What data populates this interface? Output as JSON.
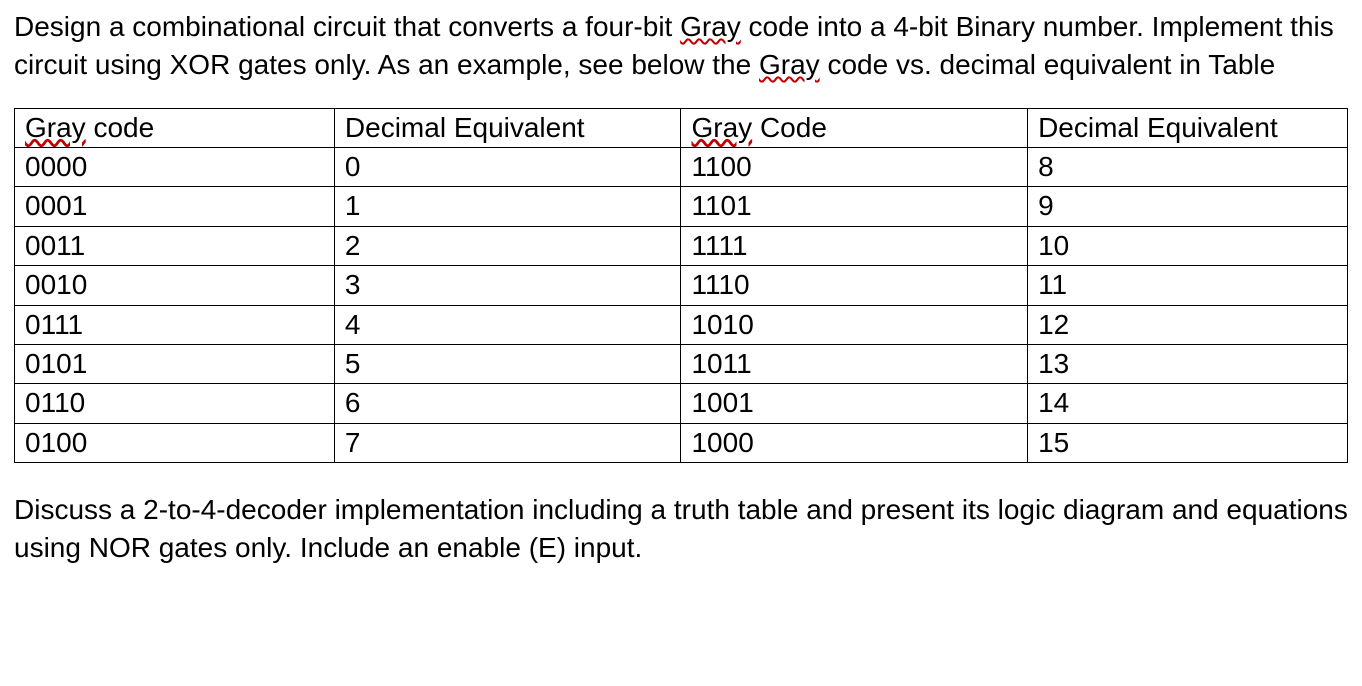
{
  "intro": {
    "seg1": "Design a combinational circuit that converts a four-bit ",
    "gray1": "Gray",
    "seg2": " code into a 4-bit Binary number. Implement this circuit using XOR gates only. As an example, see below the ",
    "gray2": "Gray",
    "seg3": " code vs. decimal equivalent in Table"
  },
  "table": {
    "headers": {
      "h1a": "Gray",
      "h1b": " code",
      "h2": "Decimal Equivalent",
      "h3a": "Gray",
      "h3b": " Code",
      "h4": "Decimal Equivalent"
    },
    "rows": [
      {
        "c1": "0000",
        "c2": "0",
        "c3": "1100",
        "c4": "8"
      },
      {
        "c1": "0001",
        "c2": "1",
        "c3": "1101",
        "c4": "9"
      },
      {
        "c1": "0011",
        "c2": "2",
        "c3": "1111",
        "c4": "10"
      },
      {
        "c1": "0010",
        "c2": "3",
        "c3": "1110",
        "c4": "11"
      },
      {
        "c1": "0111",
        "c2": "4",
        "c3": "1010",
        "c4": "12"
      },
      {
        "c1": "0101",
        "c2": "5",
        "c3": "1011",
        "c4": "13"
      },
      {
        "c1": "0110",
        "c2": "6",
        "c3": "1001",
        "c4": "14"
      },
      {
        "c1": "0100",
        "c2": "7",
        "c3": "1000",
        "c4": "15"
      }
    ]
  },
  "outro": "Discuss a 2-to-4-decoder implementation including a truth table and present its logic diagram and equations using NOR gates only. Include an enable (E) input."
}
